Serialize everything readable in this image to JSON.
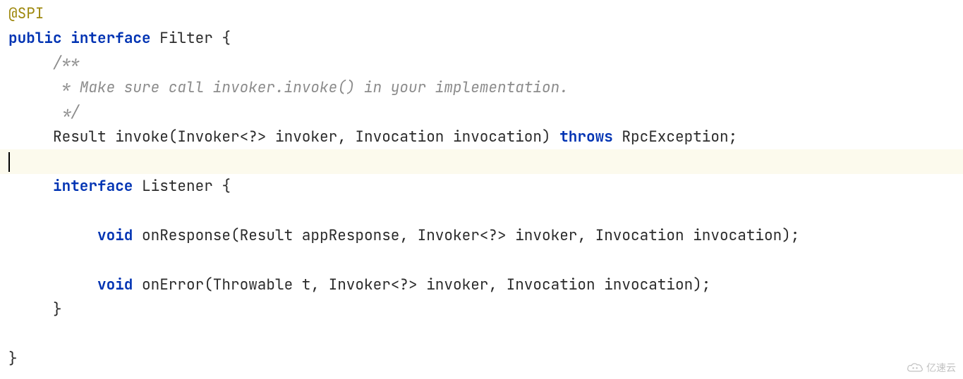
{
  "code": {
    "lines": [
      {
        "tokens": [
          {
            "t": "@SPI",
            "c": "annotation"
          }
        ]
      },
      {
        "tokens": [
          {
            "t": "public",
            "c": "kw"
          },
          {
            "t": " ",
            "c": "ident"
          },
          {
            "t": "interface",
            "c": "kw"
          },
          {
            "t": " Filter {",
            "c": "ident"
          }
        ]
      },
      {
        "tokens": [
          {
            "t": "     /**",
            "c": "comment"
          }
        ]
      },
      {
        "tokens": [
          {
            "t": "      * Make sure call invoker.invoke() in your implementation.",
            "c": "comment"
          }
        ]
      },
      {
        "tokens": [
          {
            "t": "      */",
            "c": "comment"
          }
        ]
      },
      {
        "tokens": [
          {
            "t": "     Result invoke(Invoker<?> invoker, Invocation invocation) ",
            "c": "ident"
          },
          {
            "t": "throws",
            "c": "kw"
          },
          {
            "t": " RpcException;",
            "c": "ident"
          }
        ]
      },
      {
        "highlighted": true,
        "caret": true,
        "tokens": []
      },
      {
        "tokens": [
          {
            "t": "     ",
            "c": "ident"
          },
          {
            "t": "interface",
            "c": "kw"
          },
          {
            "t": " Listener {",
            "c": "ident"
          }
        ]
      },
      {
        "tokens": []
      },
      {
        "tokens": [
          {
            "t": "          ",
            "c": "ident"
          },
          {
            "t": "void",
            "c": "kw"
          },
          {
            "t": " onResponse(Result appResponse, Invoker<?> invoker, Invocation invocation);",
            "c": "ident"
          }
        ]
      },
      {
        "tokens": []
      },
      {
        "tokens": [
          {
            "t": "          ",
            "c": "ident"
          },
          {
            "t": "void",
            "c": "kw"
          },
          {
            "t": " onError(Throwable t, Invoker<?> invoker, Invocation invocation);",
            "c": "ident"
          }
        ]
      },
      {
        "tokens": [
          {
            "t": "     }",
            "c": "ident"
          }
        ]
      },
      {
        "tokens": []
      },
      {
        "tokens": [
          {
            "t": "}",
            "c": "ident"
          }
        ]
      }
    ]
  },
  "watermark": {
    "text": "亿速云"
  }
}
